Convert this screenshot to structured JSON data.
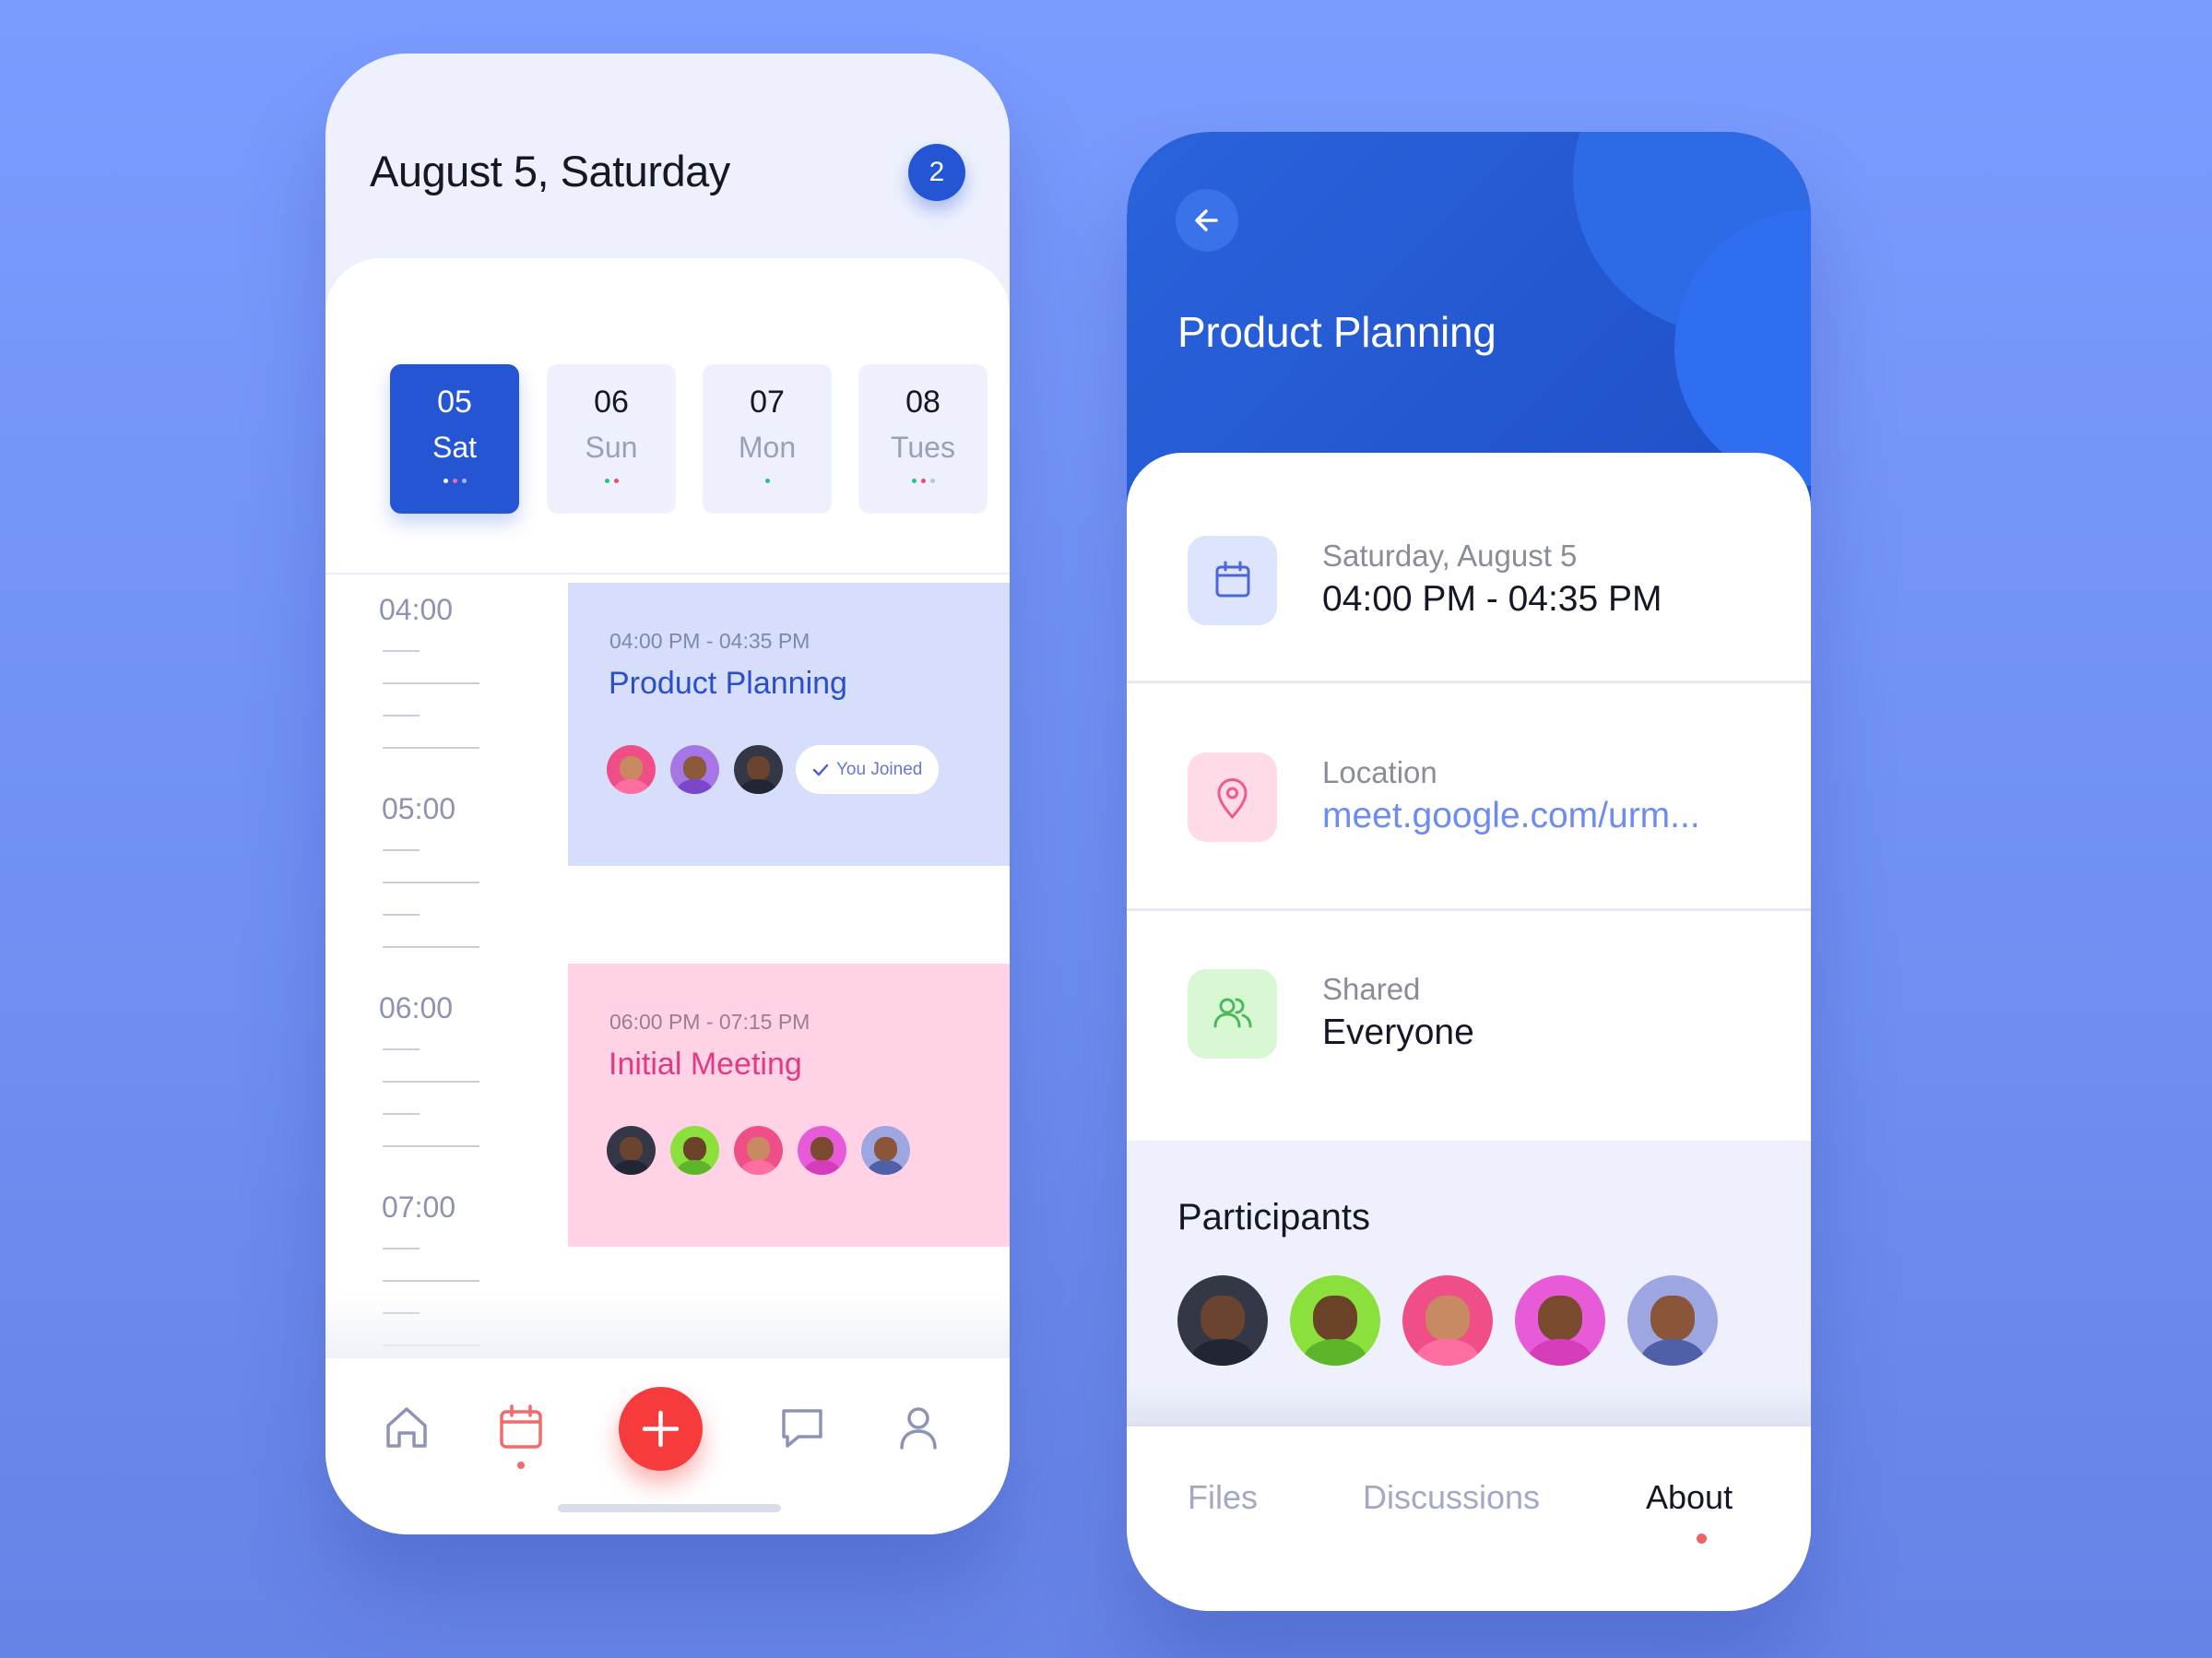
{
  "calendar": {
    "date_heading": "August 5, Saturday",
    "notification_count": "2",
    "days": [
      {
        "num": "05",
        "name": "Sat",
        "active": true,
        "dots": [
          "#ffffff",
          "#f06aa0",
          "#a8b4ff"
        ]
      },
      {
        "num": "06",
        "name": "Sun",
        "active": false,
        "dots": [
          "#2cc07a",
          "#f04a6a"
        ]
      },
      {
        "num": "07",
        "name": "Mon",
        "active": false,
        "dots": [
          "#2cc07a"
        ]
      },
      {
        "num": "08",
        "name": "Tues",
        "active": false,
        "dots": [
          "#2cc07a",
          "#f04a6a",
          "#c0c4d6"
        ]
      }
    ],
    "hours": [
      "04:00",
      "05:00",
      "06:00",
      "07:00"
    ],
    "events": [
      {
        "time": "04:00 PM - 04:35 PM",
        "title": "Product Planning",
        "joined_label": "You Joined",
        "bg": "#d7defc",
        "title_color": "#2a4fc9"
      },
      {
        "time": "06:00 PM - 07:15 PM",
        "title": "Initial Meeting",
        "bg": "#ffd2e6",
        "title_color": "#e23a82"
      }
    ],
    "nav": [
      "home-icon",
      "calendar-icon",
      "add-icon",
      "chat-icon",
      "profile-icon"
    ]
  },
  "detail": {
    "title": "Product Planning",
    "date_label": "Saturday, August 5",
    "time_value": "04:00 PM - 04:35 PM",
    "location_label": "Location",
    "location_value": "meet.google.com/urm...",
    "shared_label": "Shared",
    "shared_value": "Everyone",
    "participants_title": "Participants",
    "tabs": [
      {
        "label": "Files",
        "active": false
      },
      {
        "label": "Discussions",
        "active": false
      },
      {
        "label": "About",
        "active": true
      }
    ]
  },
  "colors": {
    "accent": "#2456d3",
    "fab": "#f53b3b",
    "background": "#7a9bff"
  }
}
